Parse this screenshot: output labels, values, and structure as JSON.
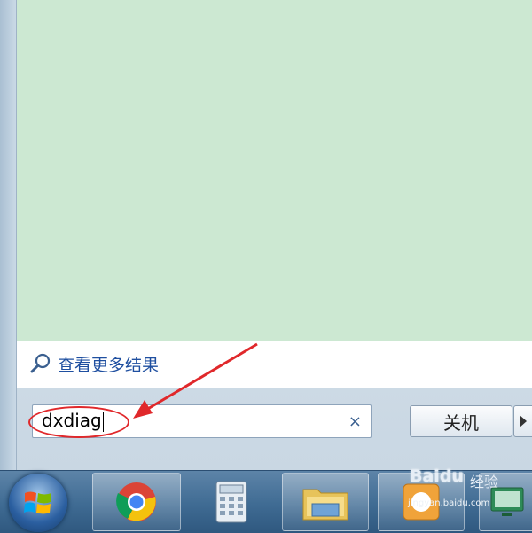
{
  "start_menu": {
    "more_results_label": "查看更多结果",
    "search": {
      "value": "dxdiag",
      "clear_symbol": "×"
    },
    "shutdown_label": "关机"
  },
  "taskbar": {
    "items": [
      "start-orb",
      "chrome-icon",
      "calculator-icon",
      "file-explorer-icon",
      "baidu-app-icon",
      "remote-app-icon"
    ]
  },
  "watermark": {
    "logo_prefix": "Bai",
    "logo_suffix": "du",
    "label": "经验",
    "url": "jingyan.baidu.com"
  },
  "colors": {
    "results_green": "#cce8d2",
    "link_blue": "#1f4fa0",
    "annotation_red": "#e0282b",
    "taskbar_blue": "#3f6b93"
  }
}
